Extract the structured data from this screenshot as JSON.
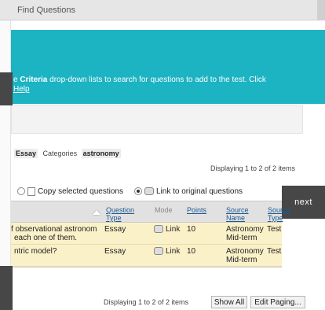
{
  "window": {
    "title": "Find Questions"
  },
  "instructions": {
    "prefix": "e ",
    "criteria_word": "Criteria",
    "rest": " drop-down lists to search for questions to add to the test. Click",
    "help_link": "Help"
  },
  "filters": {
    "type_value": "Essay",
    "categories_label": "Categories",
    "categories_value": "astronomy"
  },
  "display_count_top": "Displaying 1 to 2 of 2 items",
  "options": {
    "copy_label": "Copy selected questions",
    "link_label": "Link to original questions",
    "selected": "link"
  },
  "next_label": "next",
  "table": {
    "headers": {
      "question_type": "Question Type",
      "mode": "Mode",
      "points": "Points",
      "source_name": "Source Name",
      "source_type": "Source Type"
    },
    "rows": [
      {
        "question_line1": "f observational astronom",
        "question_line2": "each one of them.",
        "type": "Essay",
        "mode": "Link",
        "points": "10",
        "source_line1": "Astronomy",
        "source_line2": "Mid-term",
        "source_type": "Test"
      },
      {
        "question_line1": "ntric model?",
        "question_line2": "",
        "type": "Essay",
        "mode": "Link",
        "points": "10",
        "source_line1": "Astronomy",
        "source_line2": "Mid-term",
        "source_type": "Test"
      }
    ]
  },
  "footer": {
    "display_count": "Displaying 1 to 2 of 2 items",
    "show_all": "Show All",
    "edit_paging": "Edit Paging..."
  }
}
